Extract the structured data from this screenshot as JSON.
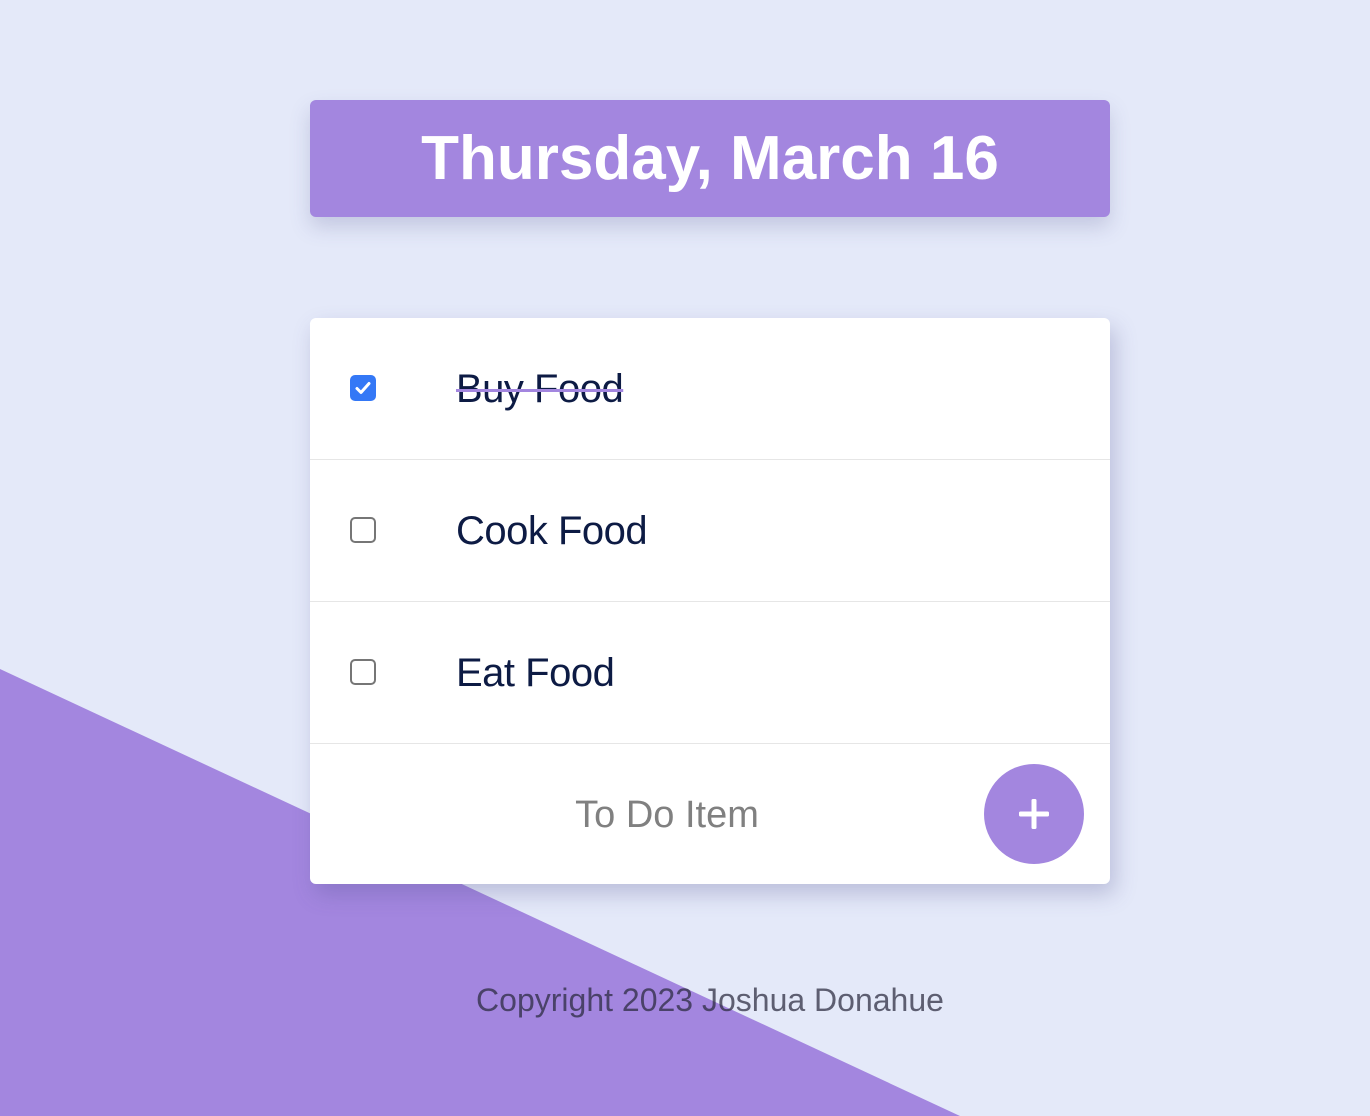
{
  "colors": {
    "background": "#E4E9F9",
    "accent": "#A386DF",
    "checkbox_checked": "#3478F6",
    "text_dark": "#0D1B44"
  },
  "header": {
    "title": "Thursday, March 16"
  },
  "todo": {
    "items": [
      {
        "label": "Buy Food",
        "checked": true
      },
      {
        "label": "Cook Food",
        "checked": false
      },
      {
        "label": "Eat Food",
        "checked": false
      }
    ],
    "new_item": {
      "placeholder": "To Do Item",
      "value": ""
    },
    "add_button_icon": "plus-icon"
  },
  "footer": {
    "text": "Copyright 2023 Joshua Donahue"
  }
}
